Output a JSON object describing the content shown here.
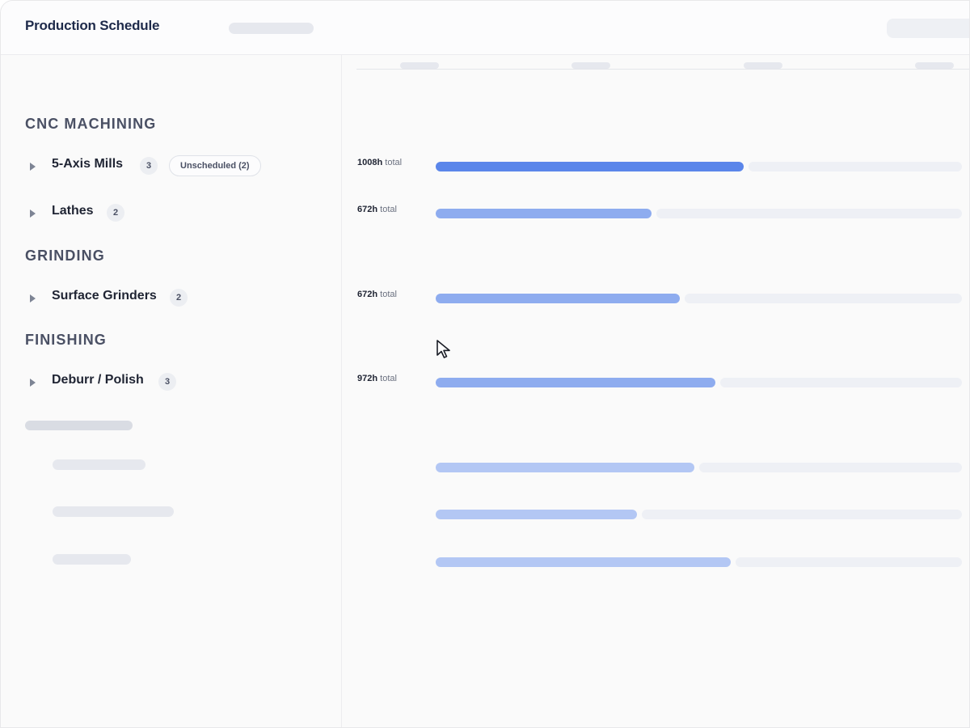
{
  "app": {
    "title": "Production Schedule"
  },
  "sidebar": {
    "groups": [
      {
        "heading": "CNC MACHINING",
        "items": [
          {
            "label": "5-Axis Mills",
            "count": "3",
            "unscheduled": "Unscheduled (2)"
          },
          {
            "label": "Lathes",
            "count": "2"
          }
        ]
      },
      {
        "heading": "GRINDING",
        "items": [
          {
            "label": "Surface Grinders",
            "count": "2"
          }
        ]
      },
      {
        "heading": "FINISHING",
        "items": [
          {
            "label": "Deburr / Polish",
            "count": "3"
          }
        ]
      }
    ]
  },
  "timeline": {
    "unit_suffix": "total",
    "rows": [
      {
        "hours": "1008h",
        "utilization": 0.585,
        "color": "#5b86ea"
      },
      {
        "hours": "672h",
        "utilization": 0.41,
        "color": "#8eacef"
      },
      {
        "hours": "672h",
        "utilization": 0.464,
        "color": "#8eacef"
      },
      {
        "hours": "972h",
        "utilization": 0.532,
        "color": "#8eacef"
      },
      {
        "hours": "",
        "utilization": 0.491,
        "color": "#b3c7f4"
      },
      {
        "hours": "",
        "utilization": 0.382,
        "color": "#b3c7f4"
      },
      {
        "hours": "",
        "utilization": 0.56,
        "color": "#b3c7f4"
      }
    ]
  },
  "colors": {
    "accent": "#5b86ea",
    "title": "#1e2a4a",
    "track_empty": "#eef0f5"
  },
  "icons": {
    "expand": "caret-right-icon",
    "pointer": "mouse-pointer-icon"
  }
}
